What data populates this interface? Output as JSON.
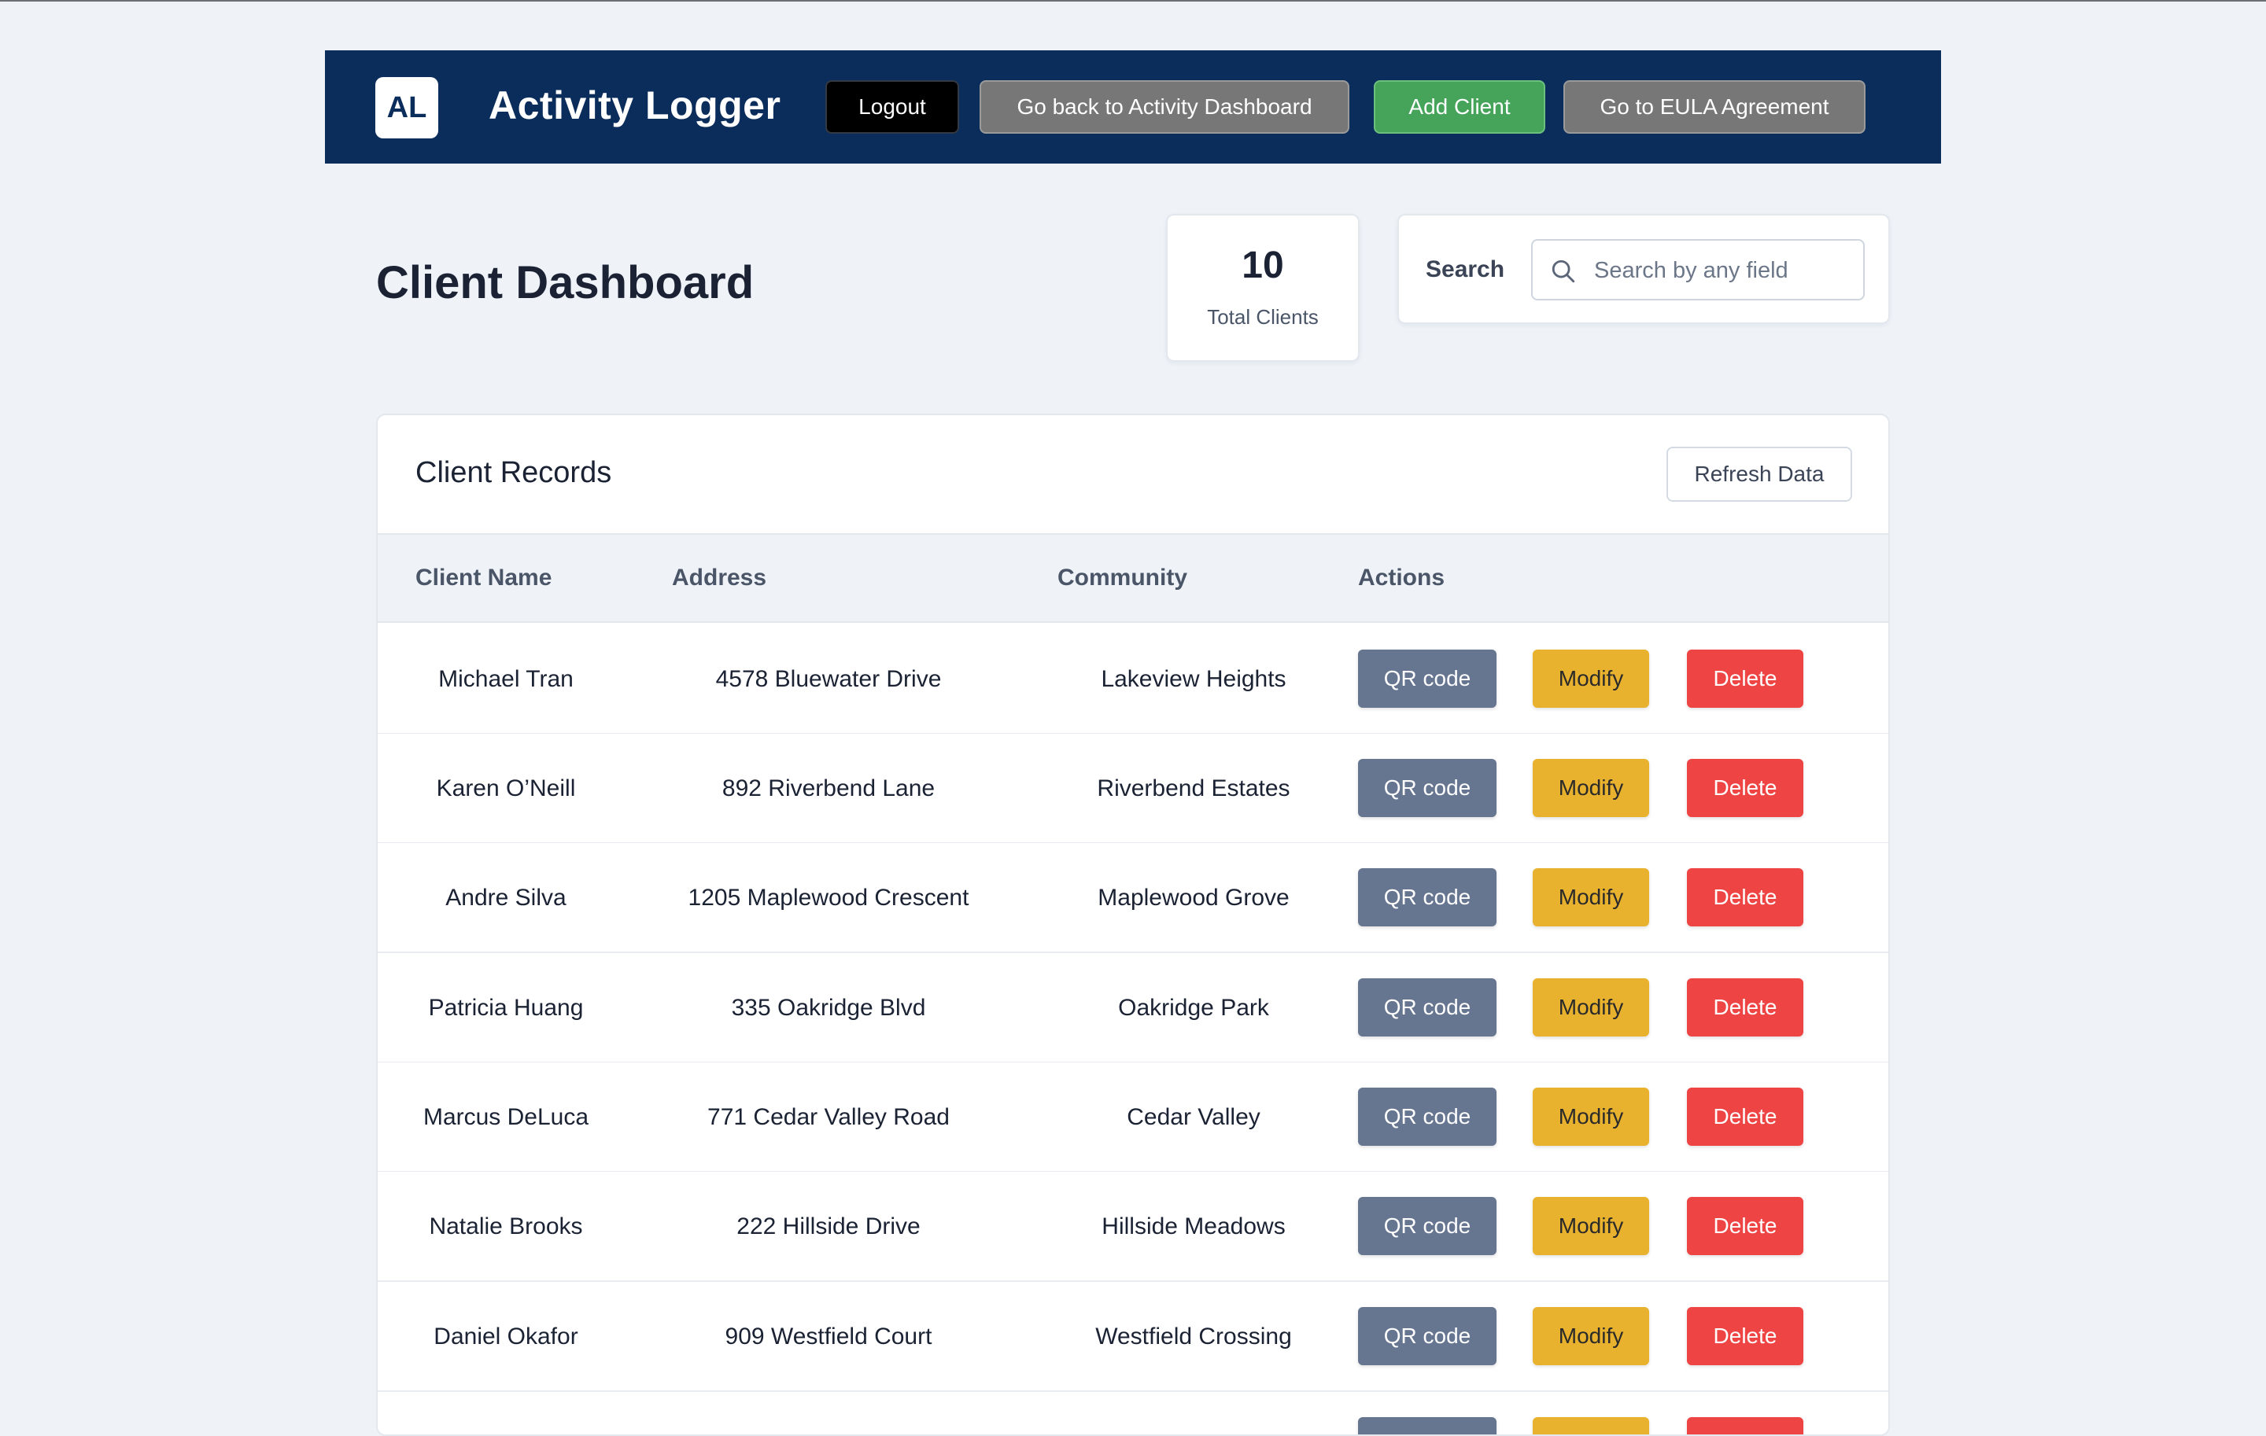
{
  "header": {
    "logo_text": "AL",
    "app_title": "Activity Logger",
    "logout_label": "Logout",
    "back_label": "Go back to Activity Dashboard",
    "add_client_label": "Add Client",
    "eula_label": "Go to EULA Agreement"
  },
  "page": {
    "title": "Client Dashboard"
  },
  "stats": {
    "total_clients_value": "10",
    "total_clients_label": "Total Clients"
  },
  "search": {
    "label": "Search",
    "placeholder": "Search by any field",
    "value": ""
  },
  "records": {
    "title": "Client Records",
    "refresh_label": "Refresh Data",
    "columns": [
      "Client Name",
      "Address",
      "Community",
      "Actions"
    ],
    "action_labels": {
      "qr": "QR code",
      "modify": "Modify",
      "delete": "Delete"
    },
    "rows": [
      {
        "name": "Michael Tran",
        "address": "4578 Bluewater Drive",
        "community": "Lakeview Heights"
      },
      {
        "name": "Karen O’Neill",
        "address": "892 Riverbend Lane",
        "community": "Riverbend Estates"
      },
      {
        "name": "Andre Silva",
        "address": "1205 Maplewood Crescent",
        "community": "Maplewood Grove"
      },
      {
        "name": "Patricia Huang",
        "address": "335 Oakridge Blvd",
        "community": "Oakridge Park"
      },
      {
        "name": "Marcus DeLuca",
        "address": "771 Cedar Valley Road",
        "community": "Cedar Valley"
      },
      {
        "name": "Natalie Brooks",
        "address": "222 Hillside Drive",
        "community": "Hillside Meadows"
      },
      {
        "name": "Daniel Okafor",
        "address": "909 Westfield Court",
        "community": "Westfield Crossing"
      }
    ]
  },
  "colors": {
    "header_bg": "#0b2d5b",
    "page_bg": "#eff3f8",
    "add_green": "#45a35a",
    "qr_slate": "#667590",
    "modify_yellow": "#e9b22e",
    "delete_red": "#ef4444"
  },
  "icons": {
    "search": "search-icon"
  }
}
